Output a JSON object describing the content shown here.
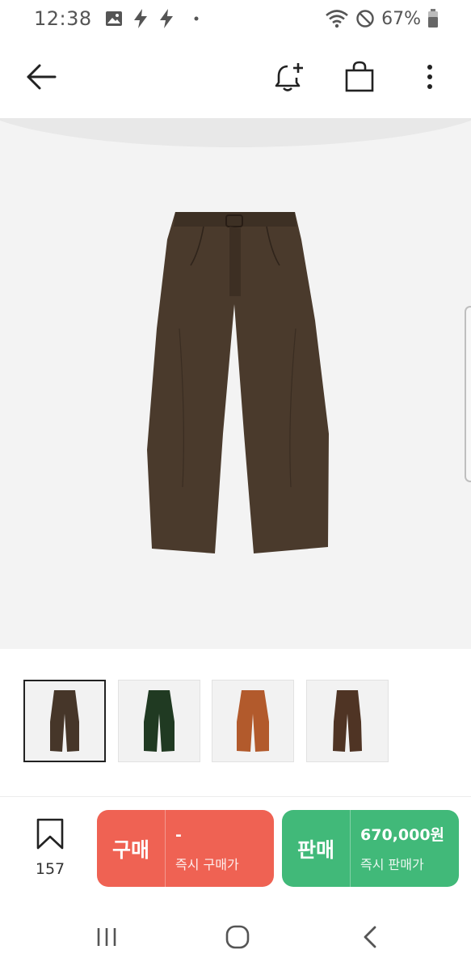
{
  "status_bar": {
    "time": "12:38",
    "battery_percent": "67%",
    "icons": [
      "image-icon",
      "flash-icon",
      "flash-icon",
      "dot-icon",
      "wifi-icon",
      "no-disturb-icon",
      "battery-icon"
    ]
  },
  "header": {
    "icons": [
      "back-arrow-icon",
      "bell-plus-icon",
      "shopping-bag-icon",
      "more-vert-icon"
    ]
  },
  "product": {
    "main_color": "#4a3a2c",
    "thumbnails": [
      {
        "color": "#463629",
        "selected": true
      },
      {
        "color": "#203a22",
        "selected": false
      },
      {
        "color": "#b25a2c",
        "selected": false
      },
      {
        "color": "#4f3424",
        "selected": false
      }
    ]
  },
  "action_bar": {
    "wish_count": "157",
    "buy": {
      "label": "구매",
      "price": "-",
      "sub": "즉시 구매가",
      "color": "#ef6253"
    },
    "sell": {
      "label": "판매",
      "price": "670,000원",
      "sub": "즉시 판매가",
      "color": "#41b979"
    }
  },
  "nav_bar": {
    "icons": [
      "recent-apps-icon",
      "home-icon",
      "back-icon"
    ]
  }
}
